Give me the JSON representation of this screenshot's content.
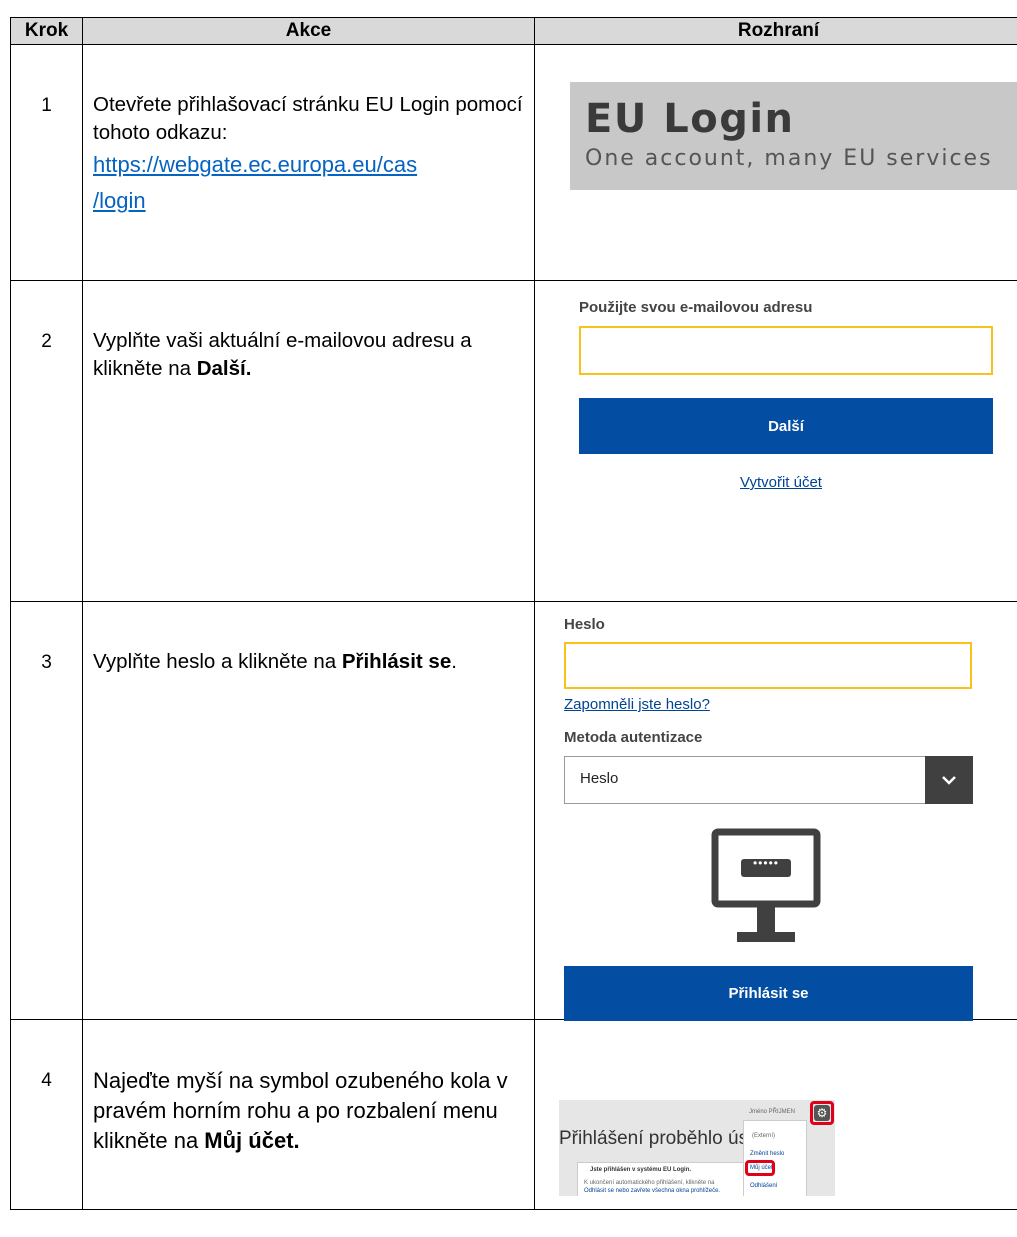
{
  "headers": {
    "step": "Krok",
    "action": "Akce",
    "interface": "Rozhraní"
  },
  "step1": {
    "num": "1",
    "text": "Otevřete přihlašovací stránku EU Login pomocí tohoto odkazu:",
    "link_line1": "https://webgate.ec.europa.eu/cas",
    "link_line2": "/login",
    "banner_title": "EU Login",
    "banner_subtitle": "One account, many EU services"
  },
  "step2": {
    "num": "2",
    "text_plain": "Vyplňte vaši aktuální e-mailovou adresu a klikněte na ",
    "text_bold": "Další.",
    "email_label": "Použijte svou e-mailovou adresu",
    "next_button": "Další",
    "create_account_link": "Vytvořit účet"
  },
  "step3": {
    "num": "3",
    "text_plain": "Vyplňte heslo a klikněte na ",
    "text_bold": "Přihlásit se",
    "text_end": ".",
    "password_label": "Heslo",
    "forgot_link": "Zapomněli jste heslo?",
    "method_label": "Metoda autentizace",
    "method_value": "Heslo",
    "login_button": "Přihlásit se",
    "monitor_dots": "•••••"
  },
  "step4": {
    "num": "4",
    "text_plain": "Najeďte myší na symbol ozubeného kola v pravém horním rohu a po rozbalení menu klikněte na ",
    "text_bold": "Můj účet.",
    "shot_title": "Přihlášení proběhlo úsp",
    "shot_user": "Jméno PŘIJMEN",
    "shot_menu": [
      "(Externí)",
      "Změnit heslo",
      "Můj účet",
      "Odhlášení"
    ],
    "shot_box_title": "Jste přihlášen v systému EU Login.",
    "shot_box_line1": "K ukončení automatického přihlášení, klikněte na",
    "shot_box_line2": "Odhlásit se nebo zavřete všechna okna prohlížeče."
  }
}
